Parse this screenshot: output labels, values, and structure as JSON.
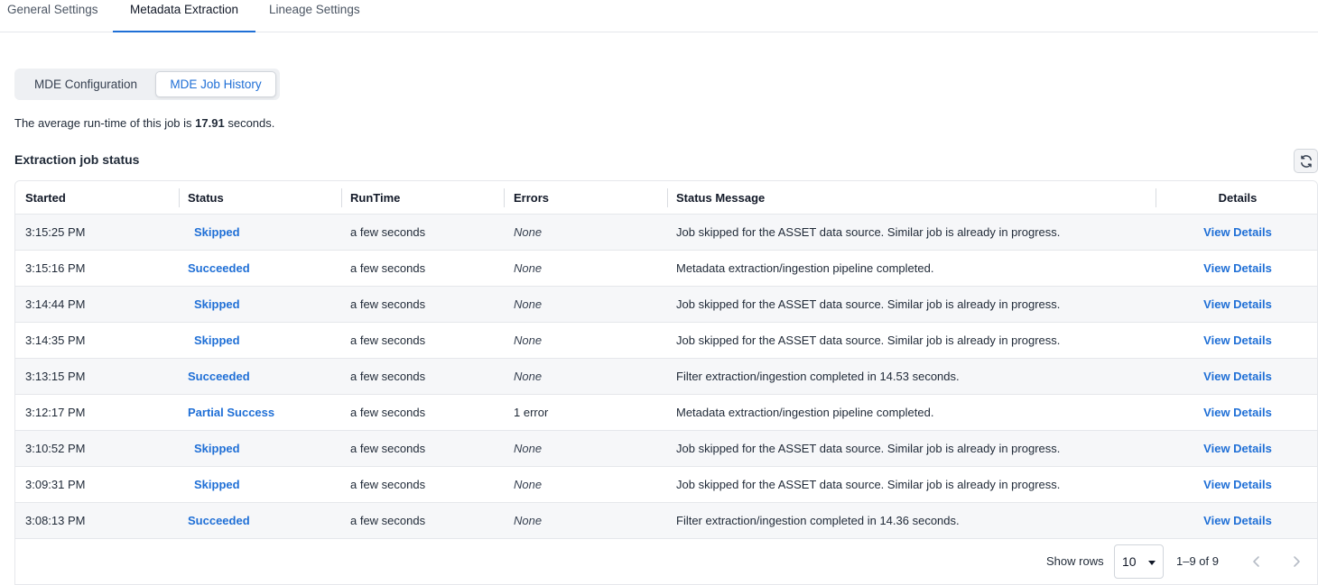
{
  "top_tabs": [
    {
      "label": "General Settings",
      "active": false
    },
    {
      "label": "Metadata Extraction",
      "active": true
    },
    {
      "label": "Lineage Settings",
      "active": false
    }
  ],
  "segments": [
    {
      "label": "MDE Configuration",
      "active": false
    },
    {
      "label": "MDE Job History",
      "active": true
    }
  ],
  "avg_runtime": {
    "prefix": "The average run-time of this job is",
    "value": "17.91",
    "suffix": "seconds."
  },
  "section": {
    "title": "Extraction job status",
    "refresh_icon": "refresh-icon"
  },
  "table": {
    "columns": [
      "Started",
      "Status",
      "RunTime",
      "Errors",
      "Status Message",
      "Details"
    ],
    "rows": [
      {
        "started": "3:15:25 PM",
        "status": "Skipped",
        "runtime": "a few seconds",
        "errors": "None",
        "message": "Job skipped for the ASSET data source. Similar job is already in progress.",
        "details": "View Details"
      },
      {
        "started": "3:15:16 PM",
        "status": "Succeeded",
        "runtime": "a few seconds",
        "errors": "None",
        "message": "Metadata extraction/ingestion pipeline completed.",
        "details": "View Details"
      },
      {
        "started": "3:14:44 PM",
        "status": "Skipped",
        "runtime": "a few seconds",
        "errors": "None",
        "message": "Job skipped for the ASSET data source. Similar job is already in progress.",
        "details": "View Details"
      },
      {
        "started": "3:14:35 PM",
        "status": "Skipped",
        "runtime": "a few seconds",
        "errors": "None",
        "message": "Job skipped for the ASSET data source. Similar job is already in progress.",
        "details": "View Details"
      },
      {
        "started": "3:13:15 PM",
        "status": "Succeeded",
        "runtime": "a few seconds",
        "errors": "None",
        "message": "Filter extraction/ingestion completed in 14.53 seconds.",
        "details": "View Details"
      },
      {
        "started": "3:12:17 PM",
        "status": "Partial Success",
        "runtime": "a few seconds",
        "errors": "1 error",
        "message": "Metadata extraction/ingestion pipeline completed.",
        "details": "View Details"
      },
      {
        "started": "3:10:52 PM",
        "status": "Skipped",
        "runtime": "a few seconds",
        "errors": "None",
        "message": "Job skipped for the ASSET data source. Similar job is already in progress.",
        "details": "View Details"
      },
      {
        "started": "3:09:31 PM",
        "status": "Skipped",
        "runtime": "a few seconds",
        "errors": "None",
        "message": "Job skipped for the ASSET data source. Similar job is already in progress.",
        "details": "View Details"
      },
      {
        "started": "3:08:13 PM",
        "status": "Succeeded",
        "runtime": "a few seconds",
        "errors": "None",
        "message": "Filter extraction/ingestion completed in 14.36 seconds.",
        "details": "View Details"
      }
    ]
  },
  "pagination": {
    "show_rows_label": "Show rows",
    "rows_per_page": "10",
    "range": "1–9 of 9",
    "prev_icon": "chevron-left-icon",
    "next_icon": "chevron-right-icon"
  },
  "colors": {
    "accent": "#1f6fd6",
    "row_stripe": "#f6f7f9",
    "border": "#e5e7eb"
  }
}
